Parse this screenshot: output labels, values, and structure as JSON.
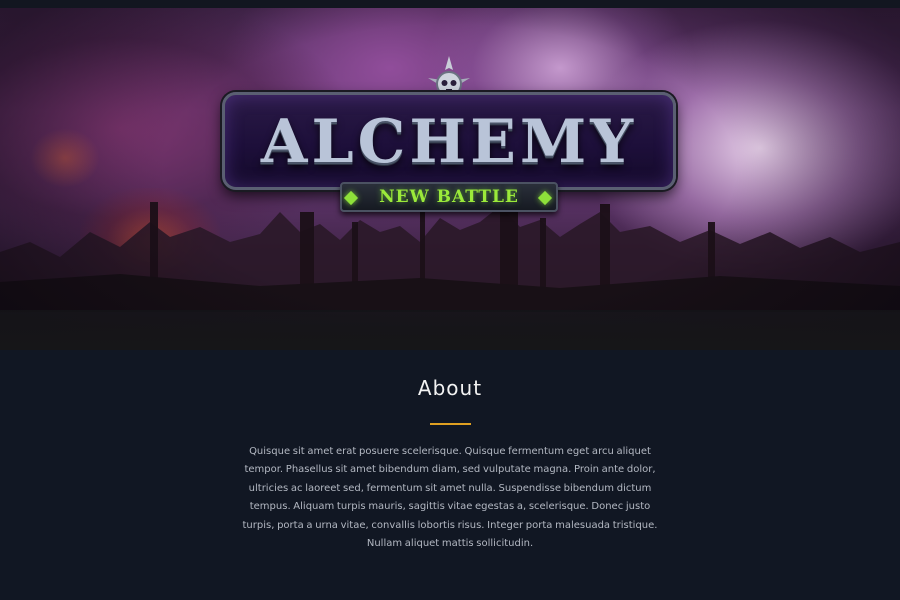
{
  "hero": {
    "logo": {
      "title": "ALCHEMY",
      "subtitle": "NEW BATTLE",
      "crest_icon": "skull-crest-icon"
    }
  },
  "about": {
    "title": "About",
    "text": "Quisque sit amet erat posuere scelerisque. Quisque fermentum eget arcu aliquet tempor. Phasellus sit amet bibendum diam, sed vulputate magna. Proin ante dolor, ultricies ac laoreet sed, fermentum sit amet nulla. Suspendisse bibendum dictum tempus. Aliquam turpis mauris, sagittis vitae egestas a, scelerisque. Donec justo turpis, porta a urna vitae, convallis lobortis risus. Integer porta malesuada tristique. Nullam aliquet mattis sollicitudin."
  },
  "colors": {
    "page_background": "#111723",
    "accent_divider": "#e0a021",
    "subtitle_green": "#9bea3a",
    "title_text": "#f2f2f2",
    "body_text": "#b3b8c2"
  }
}
